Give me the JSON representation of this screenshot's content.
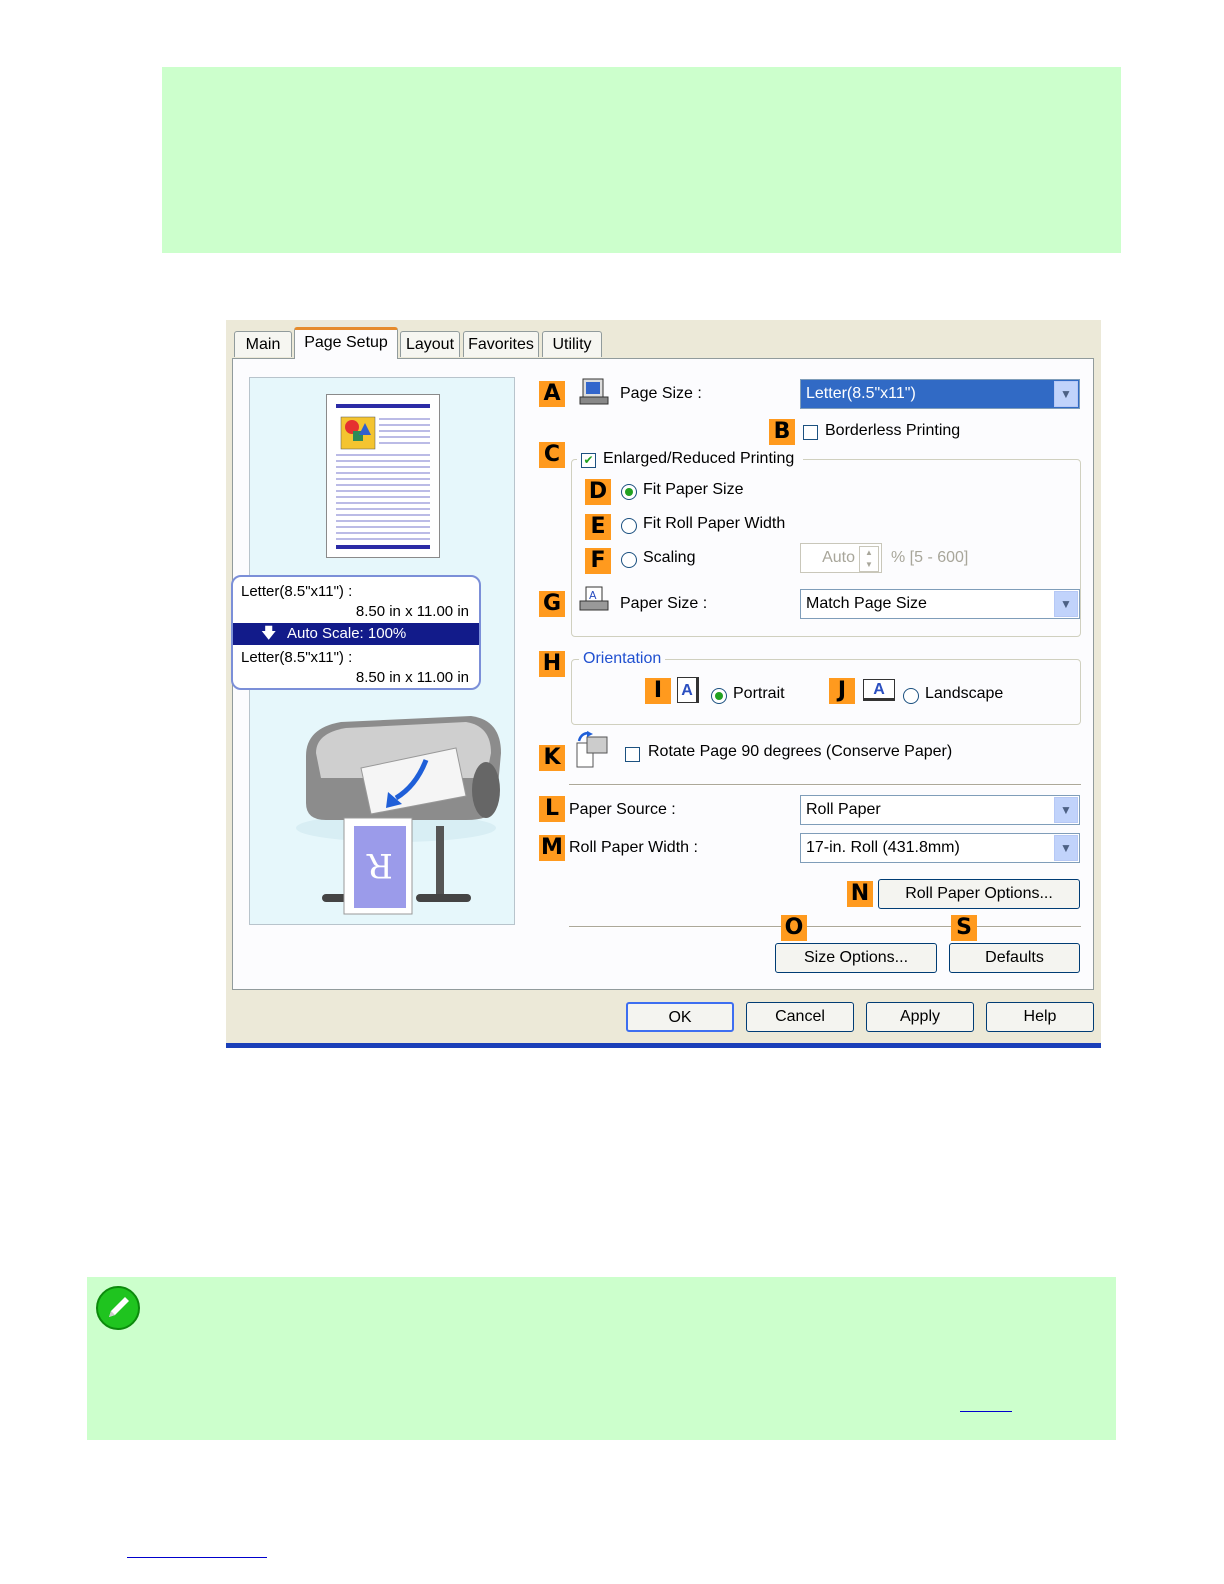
{
  "tabs": [
    "Main",
    "Page Setup",
    "Layout",
    "Favorites",
    "Utility"
  ],
  "markers": {
    "A": "A",
    "B": "B",
    "C": "C",
    "D": "D",
    "E": "E",
    "F": "F",
    "G": "G",
    "H": "H",
    "I": "I",
    "J": "J",
    "K": "K",
    "L": "L",
    "M": "M",
    "N": "N",
    "O": "O",
    "S": "S"
  },
  "page_size": {
    "label": "Page Size :",
    "value": "Letter(8.5\"x11\")"
  },
  "borderless": "Borderless Printing",
  "enlarged": "Enlarged/Reduced Printing",
  "fit_paper": "Fit Paper Size",
  "fit_roll": "Fit Roll Paper Width",
  "scaling": {
    "label": "Scaling",
    "value": "Auto",
    "range": "% [5 - 600]"
  },
  "paper_size": {
    "label": "Paper Size :",
    "value": "Match Page Size"
  },
  "orientation": {
    "title": "Orientation",
    "portrait": "Portrait",
    "landscape": "Landscape",
    "icon_letter": "A"
  },
  "rotate": "Rotate Page 90 degrees (Conserve Paper)",
  "paper_source": {
    "label": "Paper Source :",
    "value": "Roll Paper"
  },
  "roll_width": {
    "label": "Roll Paper Width :",
    "value": "17-in. Roll (431.8mm)"
  },
  "buttons": {
    "roll_options": "Roll Paper Options...",
    "size_options": "Size Options...",
    "defaults": "Defaults",
    "ok": "OK",
    "cancel": "Cancel",
    "apply": "Apply",
    "help": "Help"
  },
  "preview_info": {
    "line1": "Letter(8.5\"x11\") :",
    "line2": "8.50 in x 11.00 in",
    "scale": "Auto Scale: 100%",
    "line3": "Letter(8.5\"x11\") :",
    "line4": "8.50 in x 11.00 in"
  },
  "preview_roll_letter": "R",
  "colors": {
    "note_bg": "#ccffcc",
    "marker": "#ff9a1e",
    "selection": "#316ac5"
  }
}
